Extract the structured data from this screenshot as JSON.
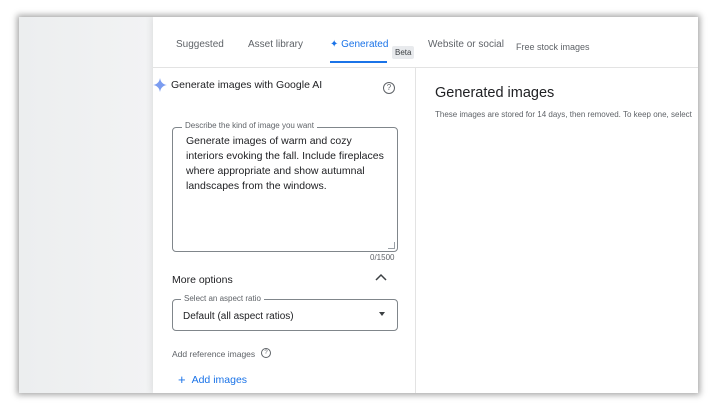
{
  "tabs": [
    {
      "label": "Suggested"
    },
    {
      "label": "Asset library"
    },
    {
      "label": "✦ Generated"
    },
    {
      "label": "Website or social"
    },
    {
      "label": "Free stock images"
    }
  ],
  "beta_badge": "Beta",
  "generator": {
    "title": "Generate images with Google AI",
    "prompt_label": "Describe the kind of image you want",
    "prompt_value": "Generate images of warm and cozy interiors evoking the fall. Include fireplaces where appropriate and show autumnal landscapes from the windows.",
    "char_counter": "0/1500",
    "more_options": "More options",
    "aspect_label": "Select an aspect ratio",
    "aspect_value": "Default (all aspect ratios)",
    "reference_label": "Add reference images",
    "add_images": "Add images"
  },
  "results": {
    "title": "Generated images",
    "subtitle": "These images are stored for 14 days, then removed. To keep one, select"
  },
  "colors": {
    "accent": "#1a73e8",
    "text": "#202124",
    "muted": "#5f6368"
  }
}
